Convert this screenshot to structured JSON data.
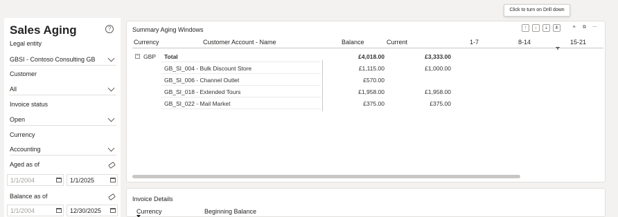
{
  "tooltip": "Click to turn on Drill down",
  "filters": {
    "title": "Sales Aging",
    "help_icon": "?",
    "legal_entity_label": "Legal entity",
    "legal_entity_value": "GBSI - Contoso Consulting GB",
    "customer_label": "Customer",
    "customer_value": "All",
    "invoice_status_label": "Invoice status",
    "invoice_status_value": "Open",
    "currency_label": "Currency",
    "currency_value": "Accounting",
    "aged_as_of_label": "Aged as of",
    "aged_from": "1/1/2004",
    "aged_to": "1/1/2025",
    "balance_as_of_label": "Balance as of",
    "balance_from": "1/1/2004",
    "balance_to": "12/30/2025"
  },
  "summary": {
    "title": "Summary Aging Windows",
    "columns": [
      "Currency",
      "Customer Account - Name",
      "Balance",
      "Current",
      "1-7",
      "8-14",
      "15-21"
    ],
    "total": {
      "currency": "GBP",
      "label": "Total",
      "balance": "£4,018.00",
      "current": "£3,333.00"
    },
    "rows": [
      {
        "name": "GB_SI_004 - Bulk Discount Store",
        "balance": "£1,115.00",
        "current": "£1,000.00"
      },
      {
        "name": "GB_SI_006 - Channel Outlet",
        "balance": "£570.00",
        "current": ""
      },
      {
        "name": "GB_SI_018 - Extended Tours",
        "balance": "£1,958.00",
        "current": "£1,958.00"
      },
      {
        "name": "GB_SI_022 - Mail Market",
        "balance": "£375.00",
        "current": "£375.00"
      }
    ]
  },
  "invoice": {
    "title": "Invoice Details",
    "columns": [
      "Currency",
      "Beginning Balance"
    ]
  },
  "icons": [
    "arrow-up-icon",
    "arrow-down-icon",
    "drill-icon",
    "expand-all-icon",
    "filter-icon",
    "focus-mode-icon",
    "more-options-icon",
    "eraser-icon",
    "calendar-icon",
    "chevron-down-icon",
    "help-icon"
  ]
}
